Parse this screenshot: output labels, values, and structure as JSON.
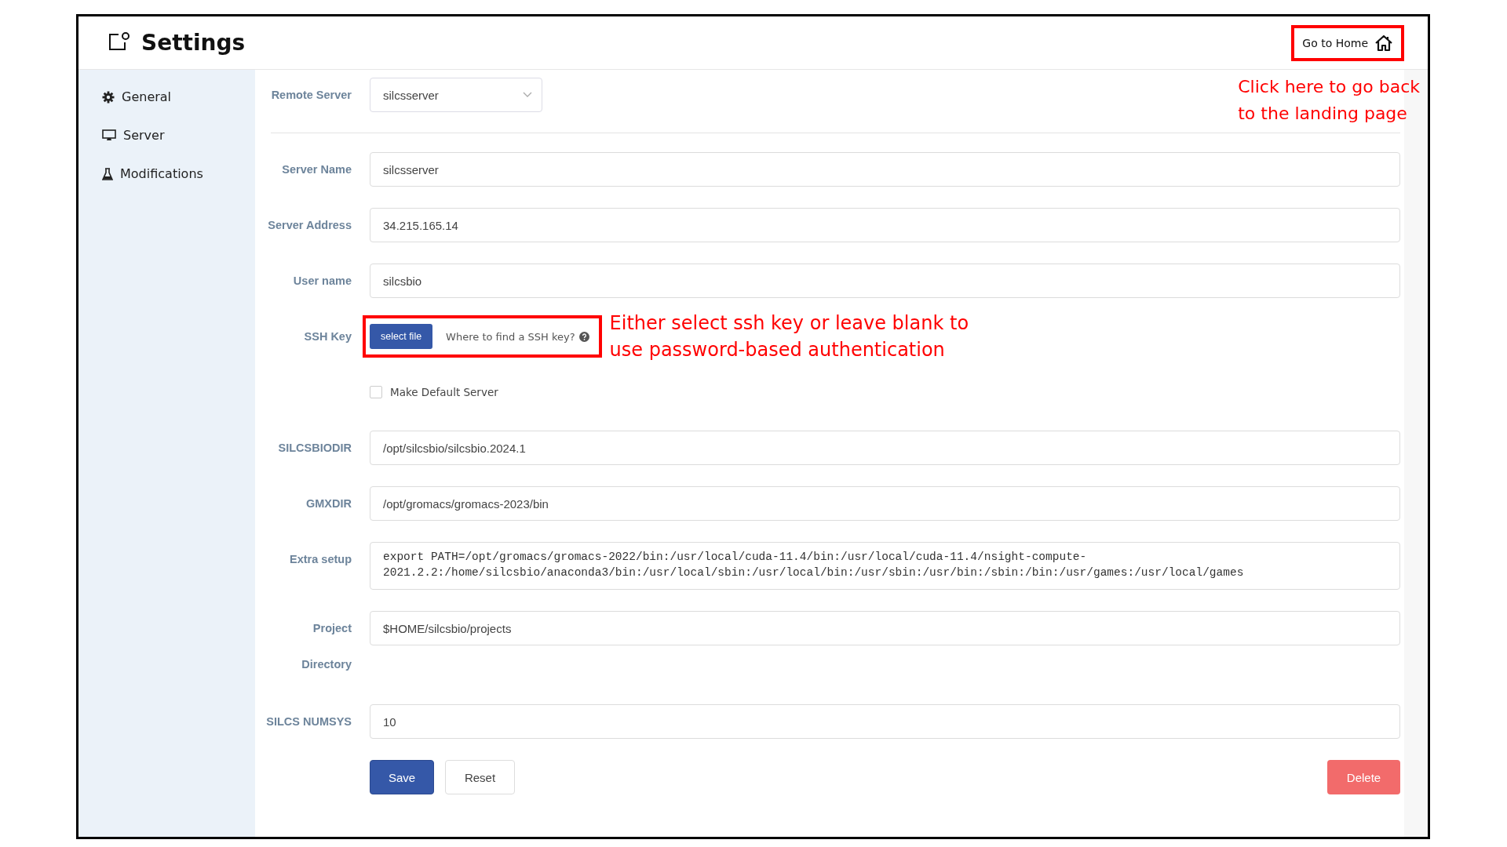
{
  "header": {
    "title": "Settings",
    "home_button": "Go to Home"
  },
  "sidebar": {
    "items": [
      {
        "kind": "general",
        "label": "General"
      },
      {
        "kind": "server",
        "label": "Server"
      },
      {
        "kind": "modifications",
        "label": "Modifications"
      }
    ]
  },
  "remote_server": {
    "label": "Remote Server",
    "value": "silcsserver"
  },
  "fields": [
    {
      "kind": "text",
      "label": "Server Name",
      "value": "silcsserver"
    },
    {
      "kind": "text",
      "label": "Server Address",
      "value": "34.215.165.14"
    },
    {
      "kind": "text",
      "label": "User name",
      "value": "silcsbio"
    },
    {
      "kind": "file",
      "label": "SSH Key",
      "button": "select file",
      "help": "Where to find a SSH key?",
      "note": [
        "Either select ssh key or leave blank to",
        "use password-based authentication"
      ]
    },
    {
      "kind": "checkbox",
      "label": "Make Default Server",
      "checked": false
    },
    {
      "kind": "text",
      "label": "SILCSBIODIR",
      "value": "/opt/silcsbio/silcsbio.2024.1"
    },
    {
      "kind": "text",
      "label": "GMXDIR",
      "value": "/opt/gromacs/gromacs-2023/bin"
    },
    {
      "kind": "textarea",
      "label": "Extra setup",
      "value": "export PATH=/opt/gromacs/gromacs-2022/bin:/usr/local/cuda-11.4/bin:/usr/local/cuda-11.4/nsight-compute-2021.2.2:/home/silcsbio/anaconda3/bin:/usr/local/sbin:/usr/local/bin:/usr/sbin:/usr/bin:/sbin:/bin:/usr/games:/usr/local/games"
    },
    {
      "kind": "text",
      "label": "Project",
      "label_2": "Directory",
      "value": "$HOME/silcsbio/projects"
    },
    {
      "kind": "text",
      "label": "SILCS NUMSYS",
      "value": "10"
    }
  ],
  "buttons": {
    "save": "Save",
    "reset": "Reset",
    "delete": "Delete"
  },
  "home_note": [
    "Click here to go back",
    "to the landing page"
  ]
}
